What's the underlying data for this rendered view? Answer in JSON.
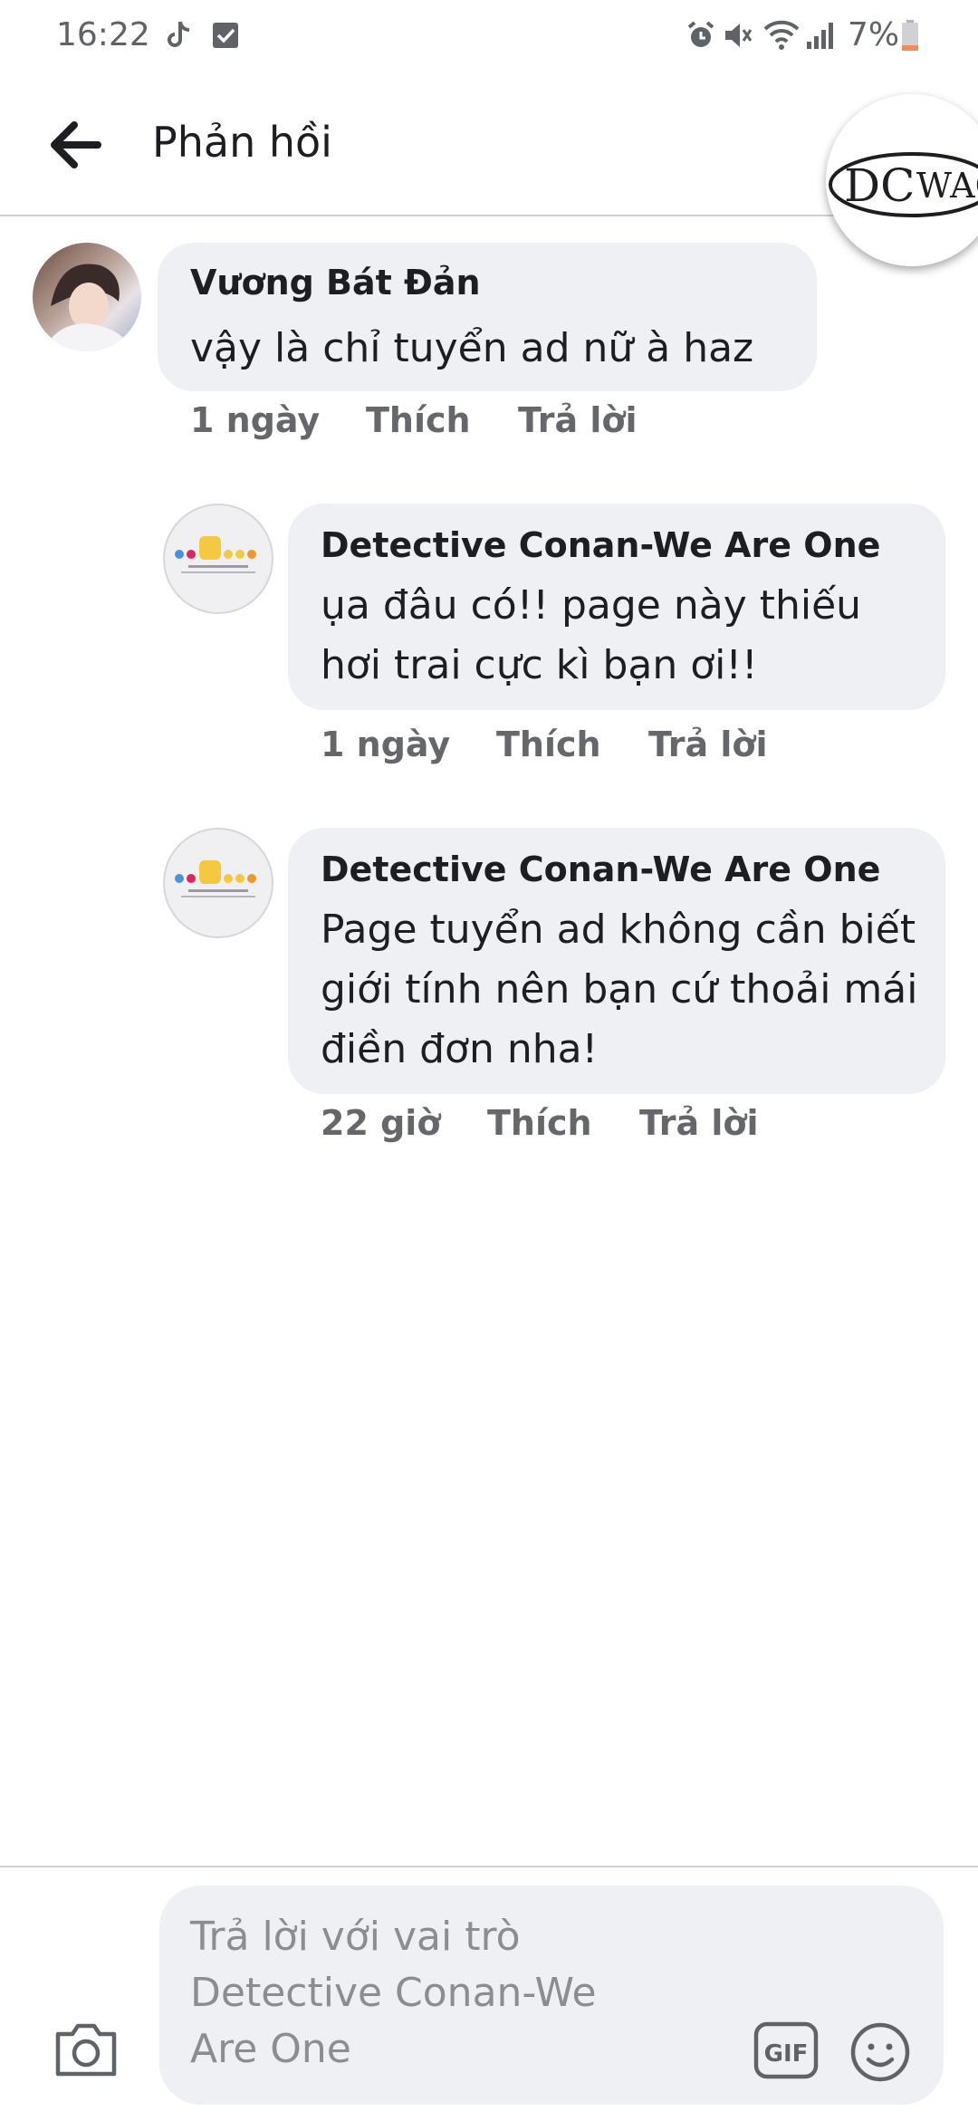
{
  "status_bar": {
    "time": "16:22",
    "battery": "7%",
    "icons": [
      "tiktok-icon",
      "check-icon",
      "alarm-icon",
      "mute-icon",
      "wifi-icon",
      "signal-icon",
      "battery-icon"
    ]
  },
  "header": {
    "title": "Phản hồi",
    "badge_text": "DC WAO"
  },
  "comments": [
    {
      "author": "Vương Bát Đản",
      "text": "vậy là chỉ tuyển ad nữ à haz",
      "time": "1 ngày",
      "like_label": "Thích",
      "reply_label": "Trả lời"
    },
    {
      "author": "Detective Conan-We Are One",
      "text": "ụa đâu có!! page này thiếu hơi trai cực kì bạn ơi!!",
      "time": "1 ngày",
      "like_label": "Thích",
      "reply_label": "Trả lời"
    },
    {
      "author": "Detective Conan-We Are One",
      "text": "Page tuyển ad không cần biết giới tính nên bạn cứ thoải mái điền đơn nha!",
      "time": "22 giờ",
      "like_label": "Thích",
      "reply_label": "Trả lời"
    }
  ],
  "composer": {
    "placeholder": "Trả lời với vai trò Detective Conan-We Are One",
    "gif_label": "GIF"
  },
  "colors": {
    "bubble": "#eff0f3",
    "meta_text": "#65676b",
    "divider": "#cfd1d5",
    "placeholder": "#8a8d91"
  }
}
